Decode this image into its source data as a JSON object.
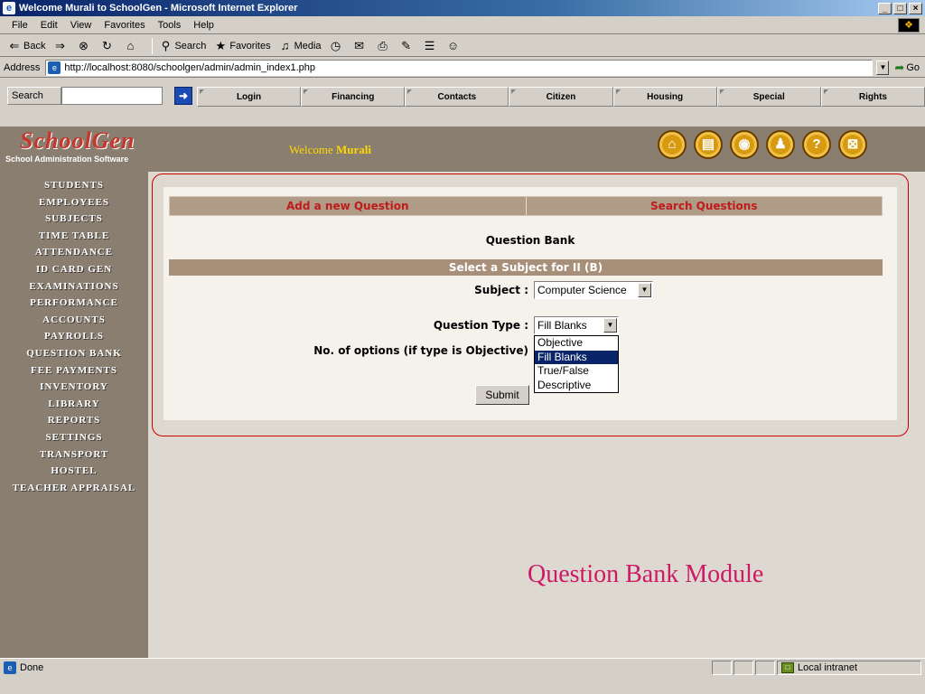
{
  "window": {
    "title": "Welcome Murali to SchoolGen - Microsoft Internet Explorer",
    "buttons": [
      "_",
      "□",
      "×"
    ]
  },
  "menu": [
    "File",
    "Edit",
    "View",
    "Favorites",
    "Tools",
    "Help"
  ],
  "toolbar": {
    "back": "Back",
    "search": "Search",
    "favorites": "Favorites",
    "media": "Media"
  },
  "address": {
    "label": "Address",
    "url": "http://localhost:8080/schoolgen/admin/admin_index1.php",
    "go": "Go"
  },
  "links": {
    "search_label": "Search",
    "tabs": [
      "Login",
      "Financing",
      "Contacts",
      "Citizen",
      "Housing",
      "Special",
      "Rights"
    ]
  },
  "header": {
    "logo_name": "SchoolGen",
    "logo_sub": "School Administration Software",
    "welcome_prefix": "Welcome ",
    "welcome_user": "Murali",
    "icons": [
      "home-icon",
      "book-icon",
      "globe-icon",
      "people-icon",
      "help-icon",
      "close-icon"
    ]
  },
  "sidebar": {
    "items": [
      "STUDENTS",
      "EMPLOYEES",
      "SUBJECTS",
      "TIME TABLE",
      "ATTENDANCE",
      "ID CARD GEN",
      "EXAMINATIONS",
      "PERFORMANCE",
      "ACCOUNTS",
      "PAYROLLS",
      "QUESTION BANK",
      "FEE PAYMENTS",
      "INVENTORY",
      "LIBRARY",
      "REPORTS",
      "SETTINGS",
      "TRANSPORT",
      "HOSTEL",
      "TEACHER APPRAISAL"
    ]
  },
  "panel": {
    "tab_add": "Add a new Question",
    "tab_search": "Search Questions",
    "title": "Question Bank",
    "subject_band": "Select a Subject for II (B)",
    "subject_label": "Subject :",
    "subject_value": "Computer Science",
    "qtype_label": "Question Type :",
    "qtype_value": "Fill Blanks",
    "options_label": "No. of options (if type is Objective)",
    "qtype_options": [
      "Objective",
      "Fill Blanks",
      "True/False",
      "Descriptive"
    ],
    "submit": "Submit"
  },
  "caption": "Question Bank Module",
  "status": {
    "text": "Done",
    "zone": "Local intranet"
  }
}
